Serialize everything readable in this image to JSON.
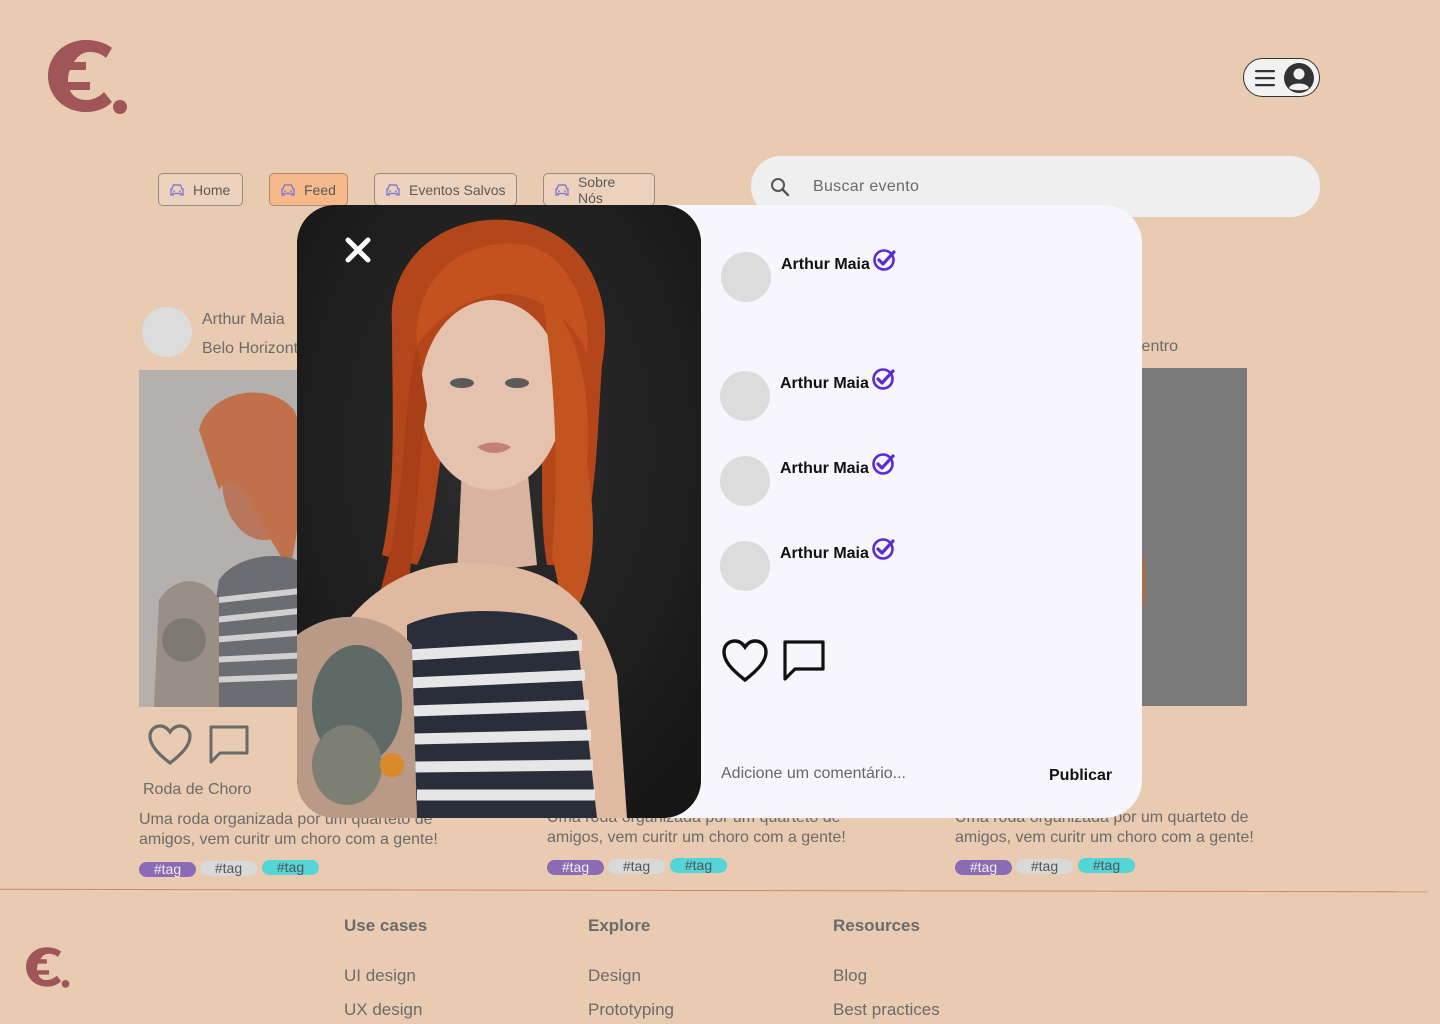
{
  "nav": {
    "items": [
      {
        "label": "Home",
        "active": false
      },
      {
        "label": "Feed",
        "active": true
      },
      {
        "label": "Eventos Salvos",
        "active": false
      },
      {
        "label": "Sobre Nós",
        "active": false
      }
    ]
  },
  "search": {
    "placeholder": "Buscar evento"
  },
  "feed": {
    "card1": {
      "author": "Arthur Maia",
      "location": "Belo Horizont",
      "title": "Roda de Choro",
      "description": "Uma roda organizada por um quarteto de amigos, vem curitr um choro com a gente!",
      "tags": [
        "#tag",
        "#tag",
        "#tag"
      ]
    },
    "card2": {
      "description": "Uma roda organizada por um quarteto de amigos, vem curitr um choro com a gente!",
      "tags": [
        "#tag",
        "#tag",
        "#tag"
      ]
    },
    "card3": {
      "location": "Centro",
      "description": "Uma roda organizada por um quarteto de amigos, vem curitr um choro com a gente!",
      "tags": [
        "#tag",
        "#tag",
        "#tag"
      ]
    }
  },
  "modal": {
    "author": "Arthur Maia",
    "comments": [
      {
        "author": "Arthur Maia"
      },
      {
        "author": "Arthur Maia"
      },
      {
        "author": "Arthur Maia"
      }
    ],
    "comment_placeholder": "Adicione um comentário...",
    "publish_label": "Publicar"
  },
  "footer": {
    "columns": [
      {
        "heading": "Use cases",
        "links": [
          "UI design",
          "UX design"
        ]
      },
      {
        "heading": "Explore",
        "links": [
          "Design",
          "Prototyping"
        ]
      },
      {
        "heading": "Resources",
        "links": [
          "Blog",
          "Best practices"
        ]
      }
    ]
  },
  "colors": {
    "background": "#e9cbb2",
    "brand": "#a05658",
    "accent_purple": "#5b2bd6",
    "tag_purple": "#8b6bb6",
    "tag_grey": "#d9d9d9",
    "tag_teal": "#54d5d8",
    "nav_active": "#f5b98a"
  }
}
